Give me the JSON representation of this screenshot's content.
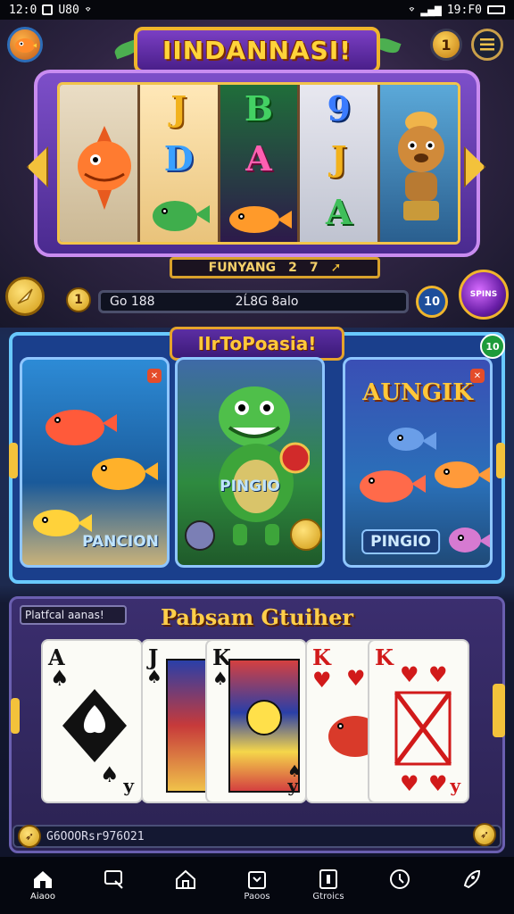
{
  "status_bar": {
    "left_time": "12:0",
    "left_text": "U80",
    "right_text": "19:F0"
  },
  "header": {
    "title": "IINDANNASI!",
    "badge_count": "1"
  },
  "slot": {
    "reel_symbols": [
      [
        "fish-dragon"
      ],
      [
        "J",
        "D",
        "frog"
      ],
      [
        "B",
        "A",
        "fish"
      ],
      [
        "9",
        "J",
        "A"
      ],
      [
        "bear-chef"
      ]
    ],
    "win_label": "FUNYANG",
    "win_value": "2",
    "win_extra": "7"
  },
  "controls": {
    "coin_level": "1",
    "balance_left": "Go 188",
    "balance_right": "2Ĺ8G 8alo",
    "bet_value": "10",
    "spin_label": "SPINS"
  },
  "featured": {
    "title": "IIrToPoasia!",
    "badge": "10",
    "games": [
      {
        "label": "PANCION"
      },
      {
        "label": "PINGIO"
      },
      {
        "label": "PINGIO",
        "headline": "AUNGIK"
      }
    ]
  },
  "poker": {
    "tag": "Platfcal aanas!",
    "title": "Pabsam Gtuiher",
    "cards": [
      {
        "rank": "A",
        "suit": "♠",
        "foot": "y",
        "color": "#111111"
      },
      {
        "rank": "J",
        "suit": "♠",
        "foot": "",
        "color": "#111111"
      },
      {
        "rank": "K",
        "suit": "♠",
        "foot": "y",
        "color": "#111111"
      },
      {
        "rank": "K",
        "suit": "♥",
        "foot": "",
        "color": "#d11a1a"
      },
      {
        "rank": "K",
        "suit": "♥",
        "foot": "y",
        "color": "#d11a1a"
      }
    ],
    "footer_text": "G6OOORsr976O21"
  },
  "nav": {
    "items": [
      {
        "label": "Aiaoo",
        "icon": "home-icon"
      },
      {
        "label": "",
        "icon": "search-icon"
      },
      {
        "label": "",
        "icon": "house-icon"
      },
      {
        "label": "Paoos",
        "icon": "gift-icon"
      },
      {
        "label": "Gtroics",
        "icon": "card-icon"
      },
      {
        "label": "",
        "icon": "clock-icon"
      },
      {
        "label": "",
        "icon": "rocket-icon"
      }
    ]
  },
  "colors": {
    "accent_gold": "#f3c23b",
    "panel_blue": "#1a3f8c",
    "panel_purple": "#3b2e6f"
  }
}
